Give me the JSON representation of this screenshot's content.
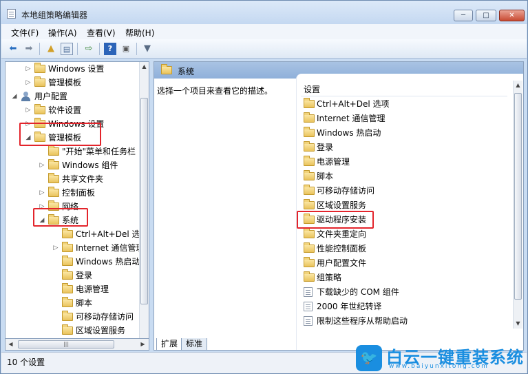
{
  "window": {
    "title": "本地组策略编辑器",
    "controls": {
      "minimize": "─",
      "maximize": "□",
      "close": "✕"
    }
  },
  "menubar": {
    "items": [
      {
        "label": "文件(F)"
      },
      {
        "label": "操作(A)"
      },
      {
        "label": "查看(V)"
      },
      {
        "label": "帮助(H)"
      }
    ]
  },
  "toolbar": {
    "icons": [
      "back-arrow-icon",
      "forward-arrow-icon",
      "up-folder-icon",
      "show-hide-tree-icon",
      "export-list-icon",
      "help-icon",
      "properties-icon",
      "filter-icon"
    ]
  },
  "tree": {
    "items": [
      {
        "label": "Windows 设置",
        "type": "folder",
        "arrow": "▷",
        "level": 1
      },
      {
        "label": "管理模板",
        "type": "folder",
        "arrow": "▷",
        "level": 1
      },
      {
        "label": "用户配置",
        "type": "users",
        "arrow": "◢",
        "level": 0
      },
      {
        "label": "软件设置",
        "type": "folder",
        "arrow": "▷",
        "level": 1
      },
      {
        "label": "Windows 设置",
        "type": "folder",
        "arrow": "▷",
        "level": 1
      },
      {
        "label": "管理模板",
        "type": "folder",
        "arrow": "◢",
        "level": 1
      },
      {
        "label": "\"开始\"菜单和任务栏",
        "type": "folder",
        "arrow": "",
        "level": 2
      },
      {
        "label": "Windows 组件",
        "type": "folder",
        "arrow": "▷",
        "level": 2
      },
      {
        "label": "共享文件夹",
        "type": "folder",
        "arrow": "",
        "level": 2
      },
      {
        "label": "控制面板",
        "type": "folder",
        "arrow": "▷",
        "level": 2
      },
      {
        "label": "网络",
        "type": "folder",
        "arrow": "▷",
        "level": 2
      },
      {
        "label": "系统",
        "type": "folder",
        "arrow": "◢",
        "level": 2
      },
      {
        "label": "Ctrl+Alt+Del 选项",
        "type": "folder",
        "arrow": "",
        "level": 3
      },
      {
        "label": "Internet 通信管理",
        "type": "folder",
        "arrow": "▷",
        "level": 3
      },
      {
        "label": "Windows 热启动",
        "type": "folder",
        "arrow": "",
        "level": 3
      },
      {
        "label": "登录",
        "type": "folder",
        "arrow": "",
        "level": 3
      },
      {
        "label": "电源管理",
        "type": "folder",
        "arrow": "",
        "level": 3
      },
      {
        "label": "脚本",
        "type": "folder",
        "arrow": "",
        "level": 3
      },
      {
        "label": "可移动存储访问",
        "type": "folder",
        "arrow": "",
        "level": 3
      },
      {
        "label": "区域设置服务",
        "type": "folder",
        "arrow": "",
        "level": 3
      }
    ]
  },
  "content": {
    "header": "系统",
    "description": "选择一个项目来查看它的描述。",
    "column_header": "设置",
    "items": [
      {
        "label": "Ctrl+Alt+Del 选项",
        "type": "folder"
      },
      {
        "label": "Internet 通信管理",
        "type": "folder"
      },
      {
        "label": "Windows 热启动",
        "type": "folder"
      },
      {
        "label": "登录",
        "type": "folder"
      },
      {
        "label": "电源管理",
        "type": "folder"
      },
      {
        "label": "脚本",
        "type": "folder"
      },
      {
        "label": "可移动存储访问",
        "type": "folder"
      },
      {
        "label": "区域设置服务",
        "type": "folder"
      },
      {
        "label": "驱动程序安装",
        "type": "folder"
      },
      {
        "label": "文件夹重定向",
        "type": "folder"
      },
      {
        "label": "性能控制面板",
        "type": "folder"
      },
      {
        "label": "用户配置文件",
        "type": "folder"
      },
      {
        "label": "组策略",
        "type": "folder"
      },
      {
        "label": "下载缺少的 COM 组件",
        "type": "policy"
      },
      {
        "label": "2000 年世纪转译",
        "type": "policy"
      },
      {
        "label": "限制这些程序从帮助启动",
        "type": "policy"
      }
    ]
  },
  "tabs": [
    {
      "label": "扩展"
    },
    {
      "label": "标准"
    }
  ],
  "statusbar": {
    "text": "10 个设置"
  },
  "watermark": {
    "name": "白云一键重装系统",
    "url": "www.baiyunxitong.com",
    "color": "#1a8ee0"
  },
  "highlight_color": "#e3242b"
}
